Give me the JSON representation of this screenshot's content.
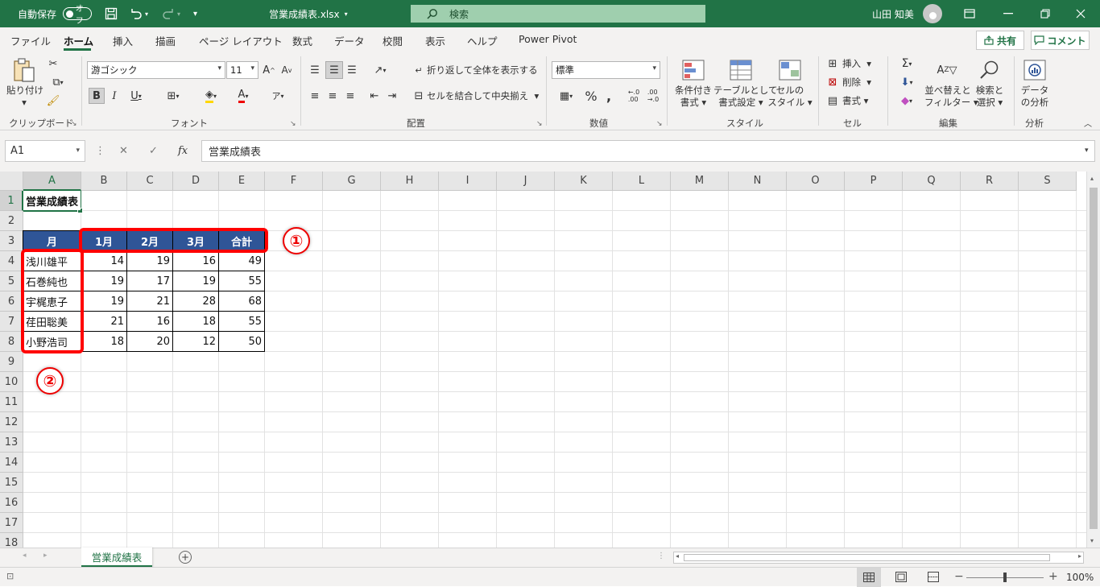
{
  "titlebar": {
    "autosave_label": "自動保存",
    "autosave_state": "オフ",
    "filename": "営業成績表.xlsx",
    "search_placeholder": "検索",
    "user_name": "山田 知美"
  },
  "menu": {
    "tabs": [
      "ファイル",
      "ホーム",
      "挿入",
      "描画",
      "ページ レイアウト",
      "数式",
      "データ",
      "校閲",
      "表示",
      "ヘルプ",
      "Power Pivot"
    ],
    "active": "ホーム",
    "share": "共有",
    "comment": "コメント"
  },
  "ribbon": {
    "clipboard": {
      "paste": "貼り付け",
      "label": "クリップボード"
    },
    "font": {
      "name": "游ゴシック",
      "size": "11",
      "label": "フォント"
    },
    "alignment": {
      "wrap": "折り返して全体を表示する",
      "merge": "セルを結合して中央揃え",
      "label": "配置"
    },
    "number": {
      "format": "標準",
      "label": "数値"
    },
    "styles": {
      "conditional_1": "条件付き",
      "conditional_2": "書式",
      "table_1": "テーブルとして",
      "table_2": "書式設定",
      "cell_1": "セルの",
      "cell_2": "スタイル",
      "label": "スタイル"
    },
    "cells": {
      "insert": "挿入",
      "delete": "削除",
      "format": "書式",
      "label": "セル"
    },
    "editing": {
      "sort_1": "並べ替えと",
      "sort_2": "フィルター",
      "find_1": "検索と",
      "find_2": "選択",
      "label": "編集"
    },
    "analysis": {
      "analyze_1": "データ",
      "analyze_2": "の分析",
      "label": "分析"
    }
  },
  "formula_bar": {
    "name_box": "A1",
    "content": "営業成績表"
  },
  "columns": [
    "A",
    "B",
    "C",
    "D",
    "E",
    "F",
    "G",
    "H",
    "I",
    "J",
    "K",
    "L",
    "M",
    "N",
    "O",
    "P",
    "Q",
    "R",
    "S"
  ],
  "rows": [
    "1",
    "2",
    "3",
    "4",
    "5",
    "6",
    "7",
    "8",
    "9",
    "10",
    "11",
    "12",
    "13",
    "14",
    "15",
    "16",
    "17",
    "18"
  ],
  "sheet": {
    "title": "営業成績表",
    "header": [
      "月",
      "1月",
      "2月",
      "3月",
      "合計"
    ],
    "data": [
      {
        "name": "浅川雄平",
        "values": [
          "14",
          "19",
          "16",
          "49"
        ]
      },
      {
        "name": "石巻純也",
        "values": [
          "19",
          "17",
          "19",
          "55"
        ]
      },
      {
        "name": "宇梶恵子",
        "values": [
          "19",
          "21",
          "28",
          "68"
        ]
      },
      {
        "name": "荏田聡美",
        "values": [
          "21",
          "16",
          "18",
          "55"
        ]
      },
      {
        "name": "小野浩司",
        "values": [
          "18",
          "20",
          "12",
          "50"
        ]
      }
    ]
  },
  "annotations": {
    "one": "①",
    "two": "②"
  },
  "sheet_tabs": {
    "active": "営業成績表"
  },
  "status": {
    "zoom": "100%"
  },
  "colors": {
    "excel_green": "#217346",
    "header_blue": "#2f5597",
    "highlight_red": "#ff0000"
  }
}
